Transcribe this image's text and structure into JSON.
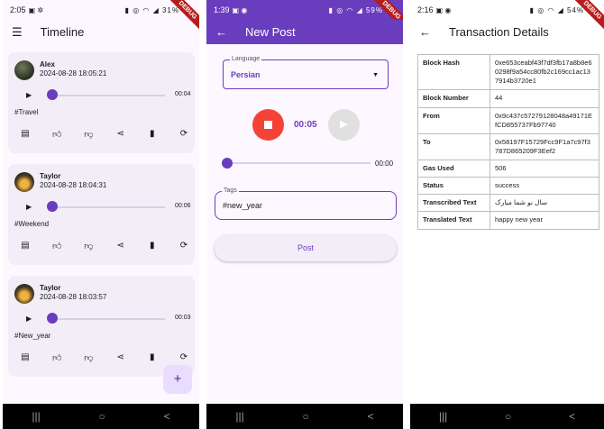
{
  "phone1": {
    "status": {
      "time": "2:05",
      "right": "31%"
    },
    "debug": "DEBUG",
    "title": "Timeline",
    "posts": [
      {
        "user": "Alex",
        "time": "2024-08-28 18:05:21",
        "duration": "00:04",
        "tag": "#Travel",
        "avatar": "alex"
      },
      {
        "user": "Taylor",
        "time": "2024-08-28 18:04:31",
        "duration": "00:06",
        "tag": "#Weekend",
        "avatar": "taylor"
      },
      {
        "user": "Taylor",
        "time": "2024-08-28 18:03:57",
        "duration": "00:03",
        "tag": "#New_year",
        "avatar": "taylor"
      }
    ],
    "fab": "+"
  },
  "phone2": {
    "status": {
      "time": "1:39",
      "right": "59%"
    },
    "debug": "DEBUG",
    "title": "New Post",
    "language_label": "Language",
    "language_value": "Persian",
    "recording_time": "00:05",
    "playback_duration": "00:00",
    "tags_label": "Tags",
    "tags_value": "#new_year",
    "post_button": "Post"
  },
  "phone3": {
    "status": {
      "time": "2:16",
      "right": "54%"
    },
    "debug": "DEBUG",
    "title": "Transaction Details",
    "rows": [
      {
        "key": "Block Hash",
        "value": "0xe653ceabf43f7df3fb17a8b8e60298f9a54cc80fb2c169cc1ac137914b3720e1"
      },
      {
        "key": "Block Number",
        "value": "44"
      },
      {
        "key": "From",
        "value": "0x9c437c57279128048a49171EfCD855737Fb97740"
      },
      {
        "key": "To",
        "value": "0x58197F15729Fcc9F1a7c97f3787D865209F3Eef2"
      },
      {
        "key": "Gas Used",
        "value": "506"
      },
      {
        "key": "Status",
        "value": "success"
      },
      {
        "key": "Transcribed Text",
        "value": "سال نو شما مبارک"
      },
      {
        "key": "Translated Text",
        "value": "happy new year"
      }
    ]
  },
  "nav": {
    "recents": "|||",
    "home": "○",
    "back": "<"
  },
  "colors": {
    "primary": "#6a3dbe",
    "record": "#f44336",
    "card": "#f3edf7"
  }
}
